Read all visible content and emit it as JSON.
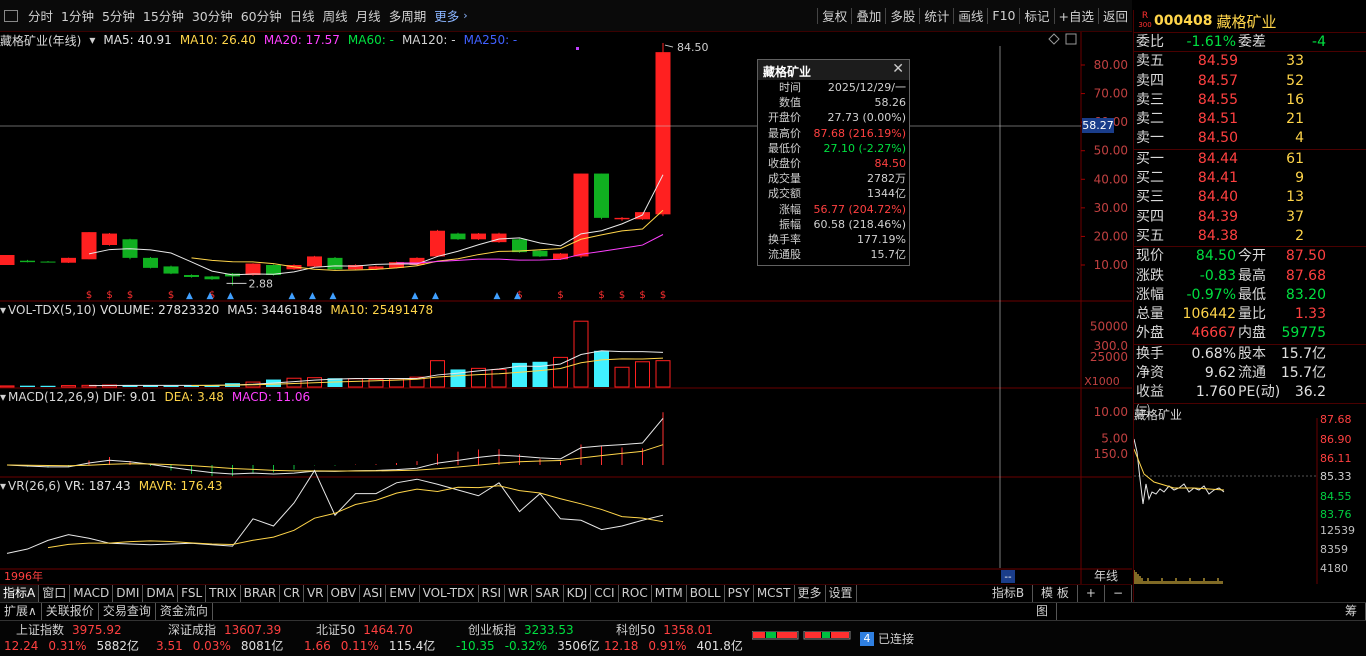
{
  "toolbar": {
    "left": [
      "分时",
      "1分钟",
      "5分钟",
      "15分钟",
      "30分钟",
      "60分钟",
      "日线",
      "周线",
      "月线",
      "多周期"
    ],
    "more": "更多",
    "right": [
      "复权",
      "叠加",
      "多股",
      "统计",
      "画线",
      "F10",
      "标记",
      "+自选",
      "返回"
    ]
  },
  "kline_header": {
    "name": "藏格矿业(年线)",
    "ma5": "MA5: 40.91",
    "ma10": "MA10: 26.40",
    "ma20": "MA20: 17.57",
    "ma60": "MA60: -",
    "ma120": "MA120: -",
    "ma250": "MA250: -"
  },
  "vol_header": {
    "name": "VOL-TDX(5,10)",
    "volume": "VOLUME: 27823320",
    "ma5": "MA5: 34461848",
    "ma10": "MA10: 25491478"
  },
  "macd_header": {
    "name": "MACD(12,26,9)",
    "dif": "DIF: 9.01",
    "dea": "DEA: 3.48",
    "macd": "MACD: 11.06"
  },
  "vr_header": {
    "name": "VR(26,6)",
    "vr": "VR: 187.43",
    "mavr": "MAVR: 176.43"
  },
  "price_axis": [
    "80.00",
    "70.00",
    "60.00",
    "50.00",
    "40.00",
    "30.00",
    "20.00",
    "10.00"
  ],
  "crosshair_value": "58.27",
  "high_label": "84.50",
  "low_label": "2.88",
  "vol_axis": [
    "50000",
    "25000"
  ],
  "vol_unit": "X1000",
  "macd_axis": [
    "10.00",
    "5.00"
  ],
  "vr_axis": [
    "300.0",
    "150.0"
  ],
  "year_label": "1996年",
  "period_label": "年线",
  "cursor_label": "--",
  "tooltip": {
    "title": "藏格矿业",
    "close_icon": "close-icon",
    "rows": [
      {
        "k": "时间",
        "v": "2025/12/29/一",
        "c": "#d0d0d0"
      },
      {
        "k": "数值",
        "v": "58.26",
        "c": "#d0d0d0"
      },
      {
        "k": "开盘价",
        "v": "27.73 (0.00%)",
        "c": "#d0d0d0"
      },
      {
        "k": "最高价",
        "v": "87.68 (216.19%)",
        "c": "#ff4040"
      },
      {
        "k": "最低价",
        "v": "27.10 (-2.27%)",
        "c": "#00e040"
      },
      {
        "k": "收盘价",
        "v": "84.50",
        "c": "#ff4040"
      },
      {
        "k": "成交量",
        "v": "2782万",
        "c": "#d0d0d0"
      },
      {
        "k": "成交额",
        "v": "1344亿",
        "c": "#d0d0d0"
      },
      {
        "k": "涨幅",
        "v": "56.77 (204.72%)",
        "c": "#ff4040"
      },
      {
        "k": "振幅",
        "v": "60.58 (218.46%)",
        "c": "#d0d0d0"
      },
      {
        "k": "换手率",
        "v": "177.19%",
        "c": "#d0d0d0"
      },
      {
        "k": "流通股",
        "v": "15.7亿",
        "c": "#d0d0d0"
      }
    ]
  },
  "quote": {
    "badge_top": "R",
    "badge_bottom": "300",
    "code": "000408",
    "name": "藏格矿业",
    "weibi": {
      "k": "委比",
      "v": "-1.61%",
      "k2": "委差",
      "v2": "-4"
    },
    "sells": [
      {
        "k": "卖五",
        "p": "84.59",
        "n": "33"
      },
      {
        "k": "卖四",
        "p": "84.57",
        "n": "52"
      },
      {
        "k": "卖三",
        "p": "84.55",
        "n": "16"
      },
      {
        "k": "卖二",
        "p": "84.51",
        "n": "21"
      },
      {
        "k": "卖一",
        "p": "84.50",
        "n": "4"
      }
    ],
    "buys": [
      {
        "k": "买一",
        "p": "84.44",
        "n": "61"
      },
      {
        "k": "买二",
        "p": "84.41",
        "n": "9"
      },
      {
        "k": "买三",
        "p": "84.40",
        "n": "13"
      },
      {
        "k": "买四",
        "p": "84.39",
        "n": "37"
      },
      {
        "k": "买五",
        "p": "84.38",
        "n": "2"
      }
    ],
    "stats": [
      {
        "k": "现价",
        "v": "84.50",
        "vc": "#00e040",
        "k2": "今开",
        "v2": "87.50",
        "v2c": "#ff4040"
      },
      {
        "k": "涨跌",
        "v": "-0.83",
        "vc": "#00e040",
        "k2": "最高",
        "v2": "87.68",
        "v2c": "#ff4040"
      },
      {
        "k": "涨幅",
        "v": "-0.97%",
        "vc": "#00e040",
        "k2": "最低",
        "v2": "83.20",
        "v2c": "#00e040"
      },
      {
        "k": "总量",
        "v": "106442",
        "vc": "#ffd54a",
        "k2": "量比",
        "v2": "1.33",
        "v2c": "#ff4040"
      },
      {
        "k": "外盘",
        "v": "46667",
        "vc": "#ff4040",
        "k2": "内盘",
        "v2": "59775",
        "v2c": "#00e040"
      }
    ],
    "stats2": [
      {
        "k": "换手",
        "v": "0.68%",
        "k2": "股本",
        "v2": "15.7亿"
      },
      {
        "k": "净资",
        "v": "9.62",
        "k2": "流通",
        "v2": "15.7亿"
      },
      {
        "k": "收益㈢",
        "v": "1.760",
        "k2": "PE(动)",
        "v2": "36.2"
      }
    ],
    "mini_title": "藏格矿业",
    "mini_axis": [
      "87.68",
      "86.90",
      "86.11",
      "85.33",
      "84.55",
      "83.76",
      "12539",
      "8359",
      "4180"
    ]
  },
  "indicator_tabs": [
    "指标A",
    "窗口",
    "MACD",
    "DMI",
    "DMA",
    "FSL",
    "TRIX",
    "BRAR",
    "CR",
    "VR",
    "OBV",
    "ASI",
    "EMV",
    "VOL-TDX",
    "RSI",
    "WR",
    "SAR",
    "KDJ",
    "CCI",
    "ROC",
    "MTM",
    "BOLL",
    "PSY",
    "MCST",
    "更多",
    "设置"
  ],
  "indicator_tabs_right": [
    "指标B",
    "模 板",
    "+",
    "−"
  ],
  "sub_tabs": [
    "扩展∧",
    "关联报价",
    "交易查询",
    "资金流向"
  ],
  "sub_right": [
    "图",
    "筹"
  ],
  "indices": [
    {
      "name": "上证指数",
      "value": "3975.92",
      "chg": "12.24",
      "pct": "0.31%",
      "amt": "5882亿"
    },
    {
      "name": "深证成指",
      "value": "13607.39",
      "chg": "3.51",
      "pct": "0.03%",
      "amt": "8081亿"
    },
    {
      "name": "北证50",
      "value": "1464.70",
      "chg": "1.66",
      "pct": "0.11%",
      "amt": "115.4亿"
    },
    {
      "name": "创业板指",
      "value": "3233.53",
      "chg": "-10.35",
      "pct": "-0.32%",
      "amt": "3506亿"
    },
    {
      "name": "科创50",
      "value": "1358.01",
      "chg": "12.18",
      "pct": "0.91%",
      "amt": "401.8亿"
    }
  ],
  "connection": {
    "num": "4",
    "text": "已连接"
  },
  "chart_data": {
    "type": "candlestick",
    "candles": [
      {
        "o": 10.0,
        "c": 13.5,
        "h": 13.5,
        "l": 10.0
      },
      {
        "o": 11.5,
        "c": 11.0,
        "h": 11.8,
        "l": 10.9
      },
      {
        "o": 11.2,
        "c": 11.0,
        "h": 11.4,
        "l": 10.9
      },
      {
        "o": 10.8,
        "c": 12.5,
        "h": 12.6,
        "l": 10.7
      },
      {
        "o": 12.0,
        "c": 21.5,
        "h": 21.5,
        "l": 12.0
      },
      {
        "o": 17.0,
        "c": 21.0,
        "h": 21.2,
        "l": 16.8
      },
      {
        "o": 19.0,
        "c": 12.5,
        "h": 19.2,
        "l": 12.0
      },
      {
        "o": 12.5,
        "c": 9.0,
        "h": 12.8,
        "l": 8.8
      },
      {
        "o": 9.5,
        "c": 7.0,
        "h": 9.8,
        "l": 6.8
      },
      {
        "o": 6.5,
        "c": 5.8,
        "h": 6.7,
        "l": 5.6
      },
      {
        "o": 6.0,
        "c": 5.0,
        "h": 6.2,
        "l": 4.8
      },
      {
        "o": 7.0,
        "c": 6.0,
        "h": 7.2,
        "l": 2.88
      },
      {
        "o": 6.5,
        "c": 10.5,
        "h": 10.6,
        "l": 6.3
      },
      {
        "o": 10.0,
        "c": 6.5,
        "h": 10.2,
        "l": 6.3
      },
      {
        "o": 8.5,
        "c": 10.0,
        "h": 10.2,
        "l": 8.3
      },
      {
        "o": 9.5,
        "c": 13.0,
        "h": 13.2,
        "l": 9.3
      },
      {
        "o": 12.5,
        "c": 8.5,
        "h": 12.8,
        "l": 8.3
      },
      {
        "o": 8.5,
        "c": 10.0,
        "h": 10.2,
        "l": 8.3
      },
      {
        "o": 8.5,
        "c": 9.5,
        "h": 9.8,
        "l": 8.3
      },
      {
        "o": 9.0,
        "c": 11.0,
        "h": 11.2,
        "l": 8.8
      },
      {
        "o": 10.0,
        "c": 12.5,
        "h": 12.7,
        "l": 9.8
      },
      {
        "o": 13.0,
        "c": 22.0,
        "h": 22.3,
        "l": 12.8
      },
      {
        "o": 21.0,
        "c": 19.0,
        "h": 21.3,
        "l": 18.8
      },
      {
        "o": 19.0,
        "c": 21.0,
        "h": 21.2,
        "l": 18.8
      },
      {
        "o": 18.0,
        "c": 21.0,
        "h": 21.3,
        "l": 17.8
      },
      {
        "o": 19.0,
        "c": 14.5,
        "h": 19.2,
        "l": 14.3
      },
      {
        "o": 15.0,
        "c": 13.0,
        "h": 15.2,
        "l": 12.8
      },
      {
        "o": 12.0,
        "c": 14.0,
        "h": 14.2,
        "l": 11.8
      },
      {
        "o": 13.0,
        "c": 42.0,
        "h": 42.0,
        "l": 12.5
      },
      {
        "o": 42.0,
        "c": 26.5,
        "h": 42.0,
        "l": 26.0
      },
      {
        "o": 26.0,
        "c": 26.5,
        "h": 26.8,
        "l": 25.5
      },
      {
        "o": 26.0,
        "c": 28.5,
        "h": 28.5,
        "l": 25.8
      },
      {
        "o": 27.73,
        "c": 84.5,
        "h": 87.68,
        "l": 27.1
      }
    ],
    "volume": [
      1,
      1.2,
      1.1,
      1.3,
      1.5,
      1.8,
      1.6,
      1.4,
      1.2,
      1.5,
      1.7,
      3.5,
      4.5,
      6.8,
      8.0,
      8.5,
      8.0,
      7.5,
      7.0,
      7.5,
      9.0,
      24,
      16,
      17,
      16,
      22,
      23,
      27,
      60,
      33,
      18,
      23,
      24
    ],
    "vr": [
      12,
      18,
      30,
      38,
      33,
      26,
      25,
      24,
      25,
      26,
      24,
      22,
      60,
      50,
      82,
      127,
      65,
      95,
      95,
      110,
      115,
      108,
      100,
      92,
      110,
      70,
      95,
      60,
      58,
      45,
      50,
      58,
      65
    ]
  }
}
